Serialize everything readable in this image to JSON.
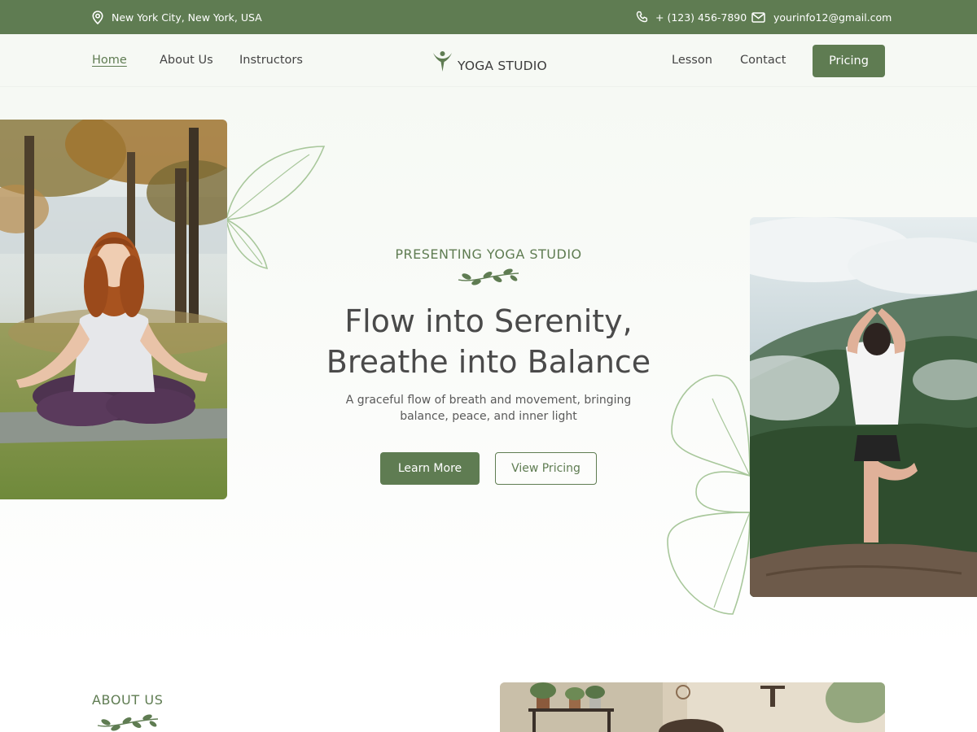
{
  "topbar": {
    "location": "New York City, New York, USA",
    "phone": "+ (123) 456-7890",
    "email": "yourinfo12@gmail.com",
    "icons": [
      "location-pin-icon",
      "phone-icon",
      "mail-icon"
    ]
  },
  "nav": {
    "items_left": [
      "Home",
      "About Us",
      "Instructors"
    ],
    "items_right": [
      "Lesson",
      "Contact"
    ],
    "active": "Home",
    "logo_text": "YOGA STUDIO",
    "cta": "Pricing"
  },
  "hero": {
    "subtitle": "PRESENTING YOGA STUDIO",
    "title_line1": "Flow into Serenity,",
    "title_line2": "Breathe into Balance",
    "description": "A graceful flow of breath and movement, bringing balance, peace, and inner light",
    "primary_button": "Learn More",
    "secondary_button": "View Pricing"
  },
  "about": {
    "heading": "ABOUT US"
  },
  "colors": {
    "accent": "#5f7c52",
    "leaf_outline": "#a8c79b",
    "text": "#4a4a4a"
  }
}
